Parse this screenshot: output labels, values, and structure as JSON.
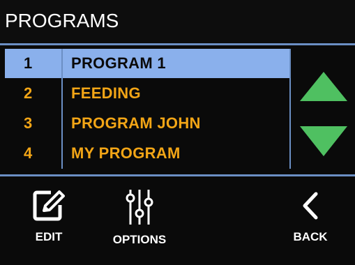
{
  "header": {
    "title": "PROGRAMS"
  },
  "programs": [
    {
      "number": "1",
      "name": "PROGRAM 1",
      "selected": true
    },
    {
      "number": "2",
      "name": "FEEDING",
      "selected": false
    },
    {
      "number": "3",
      "name": "PROGRAM JOHN",
      "selected": false
    },
    {
      "number": "4",
      "name": "MY PROGRAM",
      "selected": false
    }
  ],
  "scroll": {
    "up_icon": "triangle-up",
    "down_icon": "triangle-down",
    "arrow_color": "#4fc061"
  },
  "toolbar": {
    "edit_label": "EDIT",
    "edit_icon": "pencil-square",
    "options_label": "OPTIONS",
    "options_icon": "sliders",
    "back_label": "BACK",
    "back_icon": "chevron-left"
  },
  "colors": {
    "accent": "#6b8fc4",
    "selection": "#8ab0ec",
    "item_text": "#f2a516",
    "background": "#0a0a0a"
  }
}
